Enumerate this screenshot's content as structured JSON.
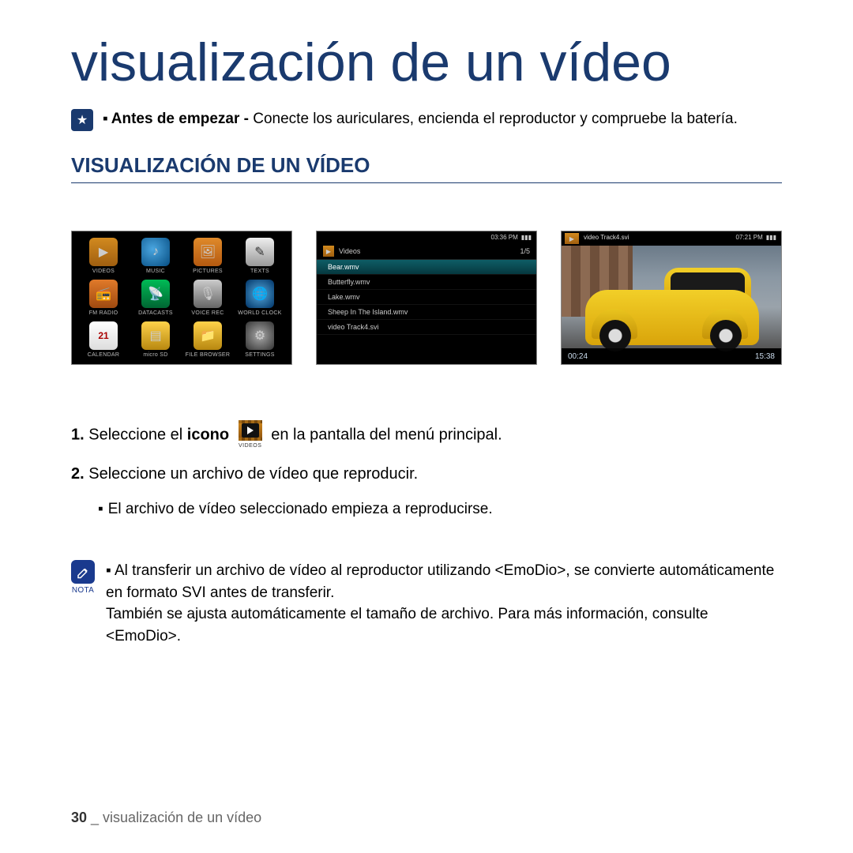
{
  "page": {
    "title": "visualización de un vídeo",
    "intro_bold": "Antes de empezar - ",
    "intro_rest": "Conecte los auriculares, encienda el reproductor y compruebe la batería.",
    "section_heading": "VISUALIZACIÓN DE UN VÍDEO"
  },
  "screens": {
    "menu_items": [
      {
        "label": "VIDEOS"
      },
      {
        "label": "MUSIC"
      },
      {
        "label": "PICTURES"
      },
      {
        "label": "TEXTS"
      },
      {
        "label": "FM RADIO"
      },
      {
        "label": "DATACASTS"
      },
      {
        "label": "VOICE REC"
      },
      {
        "label": "WORLD CLOCK"
      },
      {
        "label": "CALENDAR"
      },
      {
        "label": "micro SD"
      },
      {
        "label": "FILE BROWSER"
      },
      {
        "label": "SETTINGS"
      }
    ],
    "calendar_num": "21",
    "list": {
      "clock": "03:36 PM",
      "title": "Videos",
      "count": "1/5",
      "rows": [
        "Bear.wmv",
        "Butterfly.wmv",
        "Lake.wmv",
        "Sheep In The Island.wmv",
        "video Track4.svi"
      ]
    },
    "play": {
      "clock": "07:21 PM",
      "title": "video Track4.svi",
      "pos": "00:24",
      "dur": "15:38"
    }
  },
  "steps": {
    "s1_a": "Seleccione el ",
    "s1_b": "icono",
    "s1_c": " en la pantalla del menú principal.",
    "inline_icon_label": "VIDEOS",
    "s2": "Seleccione un archivo de vídeo que reproducir.",
    "s2_sub": "El archivo de vídeo seleccionado empieza a reproducirse."
  },
  "note": {
    "label": "NOTA",
    "line1": "Al transferir un archivo de vídeo al reproductor utilizando <EmoDio>, se convierte automáticamente en formato SVI antes de transferir.",
    "line2": "También se ajusta automáticamente el tamaño de archivo. Para más información, consulte <EmoDio>."
  },
  "footer": {
    "page_num": "30",
    "sep": " _ ",
    "section": "visualización de un vídeo"
  }
}
